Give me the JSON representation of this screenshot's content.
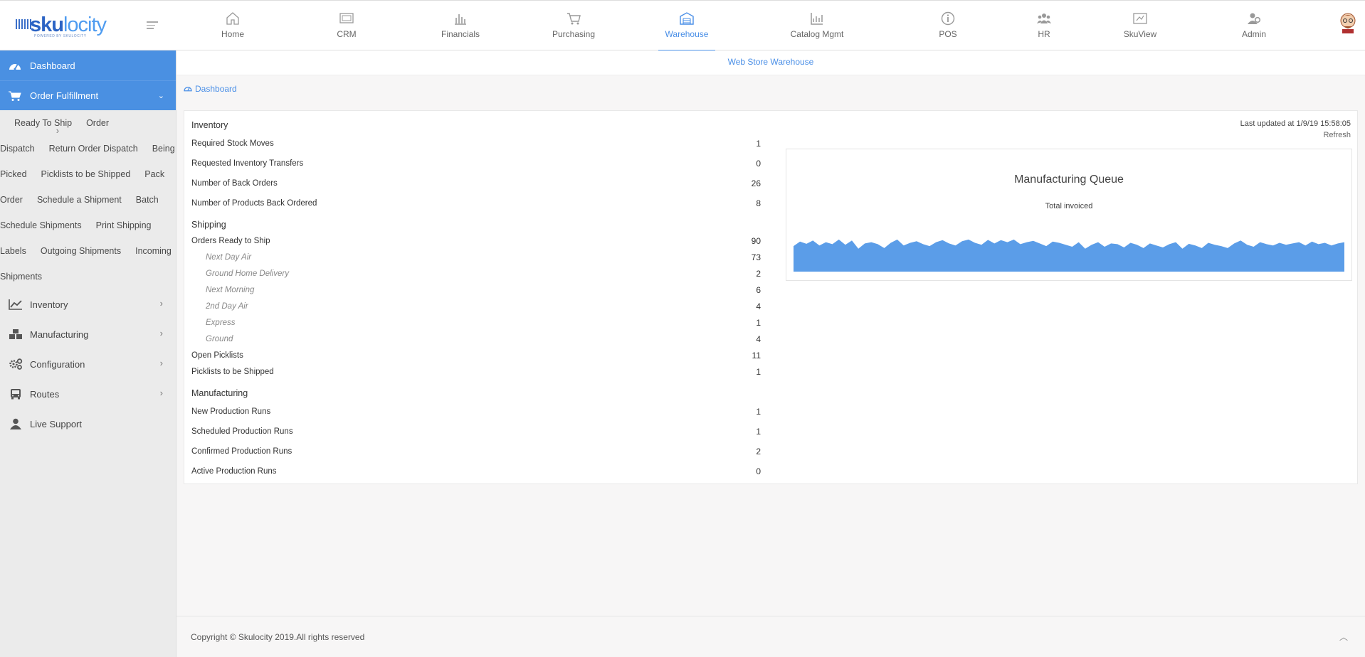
{
  "brand": {
    "name_a": "sku",
    "name_b": "locity",
    "tagline": "POWERED BY SKULOCITY"
  },
  "nav": [
    {
      "label": "Home",
      "icon": "home-icon",
      "active": false
    },
    {
      "label": "CRM",
      "icon": "crm-icon",
      "active": false
    },
    {
      "label": "Financials",
      "icon": "bar-chart-icon",
      "active": false
    },
    {
      "label": "Purchasing",
      "icon": "cart-icon",
      "active": false
    },
    {
      "label": "Warehouse",
      "icon": "warehouse-icon",
      "active": true
    },
    {
      "label": "Catalog Mgmt",
      "icon": "line-chart-icon",
      "active": false
    },
    {
      "label": "POS",
      "icon": "info-icon",
      "active": false
    },
    {
      "label": "HR",
      "icon": "people-icon",
      "active": false
    },
    {
      "label": "SkuView",
      "icon": "sku-view-icon",
      "active": false
    },
    {
      "label": "Admin",
      "icon": "admin-icon",
      "active": false
    }
  ],
  "sidebar": {
    "dashboard": "Dashboard",
    "order_fulfillment": "Order Fulfillment",
    "items": [
      {
        "label": "Ready To Ship",
        "chevron": false
      },
      {
        "label": "Order Dispatch",
        "chevron": true
      },
      {
        "label": "Return Order Dispatch",
        "chevron": false
      },
      {
        "label": "Being Picked",
        "chevron": false
      },
      {
        "label": "Picklists to be Shipped",
        "chevron": false
      },
      {
        "label": "Pack Order",
        "chevron": false
      },
      {
        "label": "Schedule a Shipment",
        "chevron": false
      },
      {
        "label": "Batch Schedule Shipments",
        "chevron": false
      },
      {
        "label": "Print Shipping Labels",
        "chevron": false
      },
      {
        "label": "Outgoing Shipments",
        "chevron": false
      },
      {
        "label": "Incoming Shipments",
        "chevron": false
      }
    ],
    "sections": [
      {
        "label": "Inventory",
        "icon": "trend-icon",
        "chevron": true
      },
      {
        "label": "Manufacturing",
        "icon": "boxes-icon",
        "chevron": true
      },
      {
        "label": "Configuration",
        "icon": "gears-icon",
        "chevron": true
      },
      {
        "label": "Routes",
        "icon": "bus-icon",
        "chevron": true
      },
      {
        "label": "Live Support",
        "icon": "user-icon",
        "chevron": false
      }
    ]
  },
  "store": "Web Store Warehouse",
  "breadcrumb": "Dashboard",
  "inventory": {
    "title": "Inventory",
    "rows": [
      {
        "label": "Required Stock Moves",
        "value": "1"
      },
      {
        "label": "Requested Inventory Transfers",
        "value": "0"
      },
      {
        "label": "Number of Back Orders",
        "value": "26"
      },
      {
        "label": "Number of Products Back Ordered",
        "value": "8"
      }
    ]
  },
  "shipping": {
    "title": "Shipping",
    "ready": {
      "label": "Orders Ready to Ship",
      "value": "90"
    },
    "methods": [
      {
        "label": "Next Day Air",
        "value": "73"
      },
      {
        "label": "Ground Home Delivery",
        "value": "2"
      },
      {
        "label": "Next Morning",
        "value": "6"
      },
      {
        "label": "2nd Day Air",
        "value": "4"
      },
      {
        "label": "Express",
        "value": "1"
      },
      {
        "label": "Ground",
        "value": "4"
      }
    ],
    "open_picklists": {
      "label": "Open Picklists",
      "value": "11"
    },
    "picklists_shipped": {
      "label": "Picklists to be Shipped",
      "value": "1"
    }
  },
  "manufacturing": {
    "title": "Manufacturing",
    "rows": [
      {
        "label": "New Production Runs",
        "value": "1"
      },
      {
        "label": "Scheduled Production Runs",
        "value": "1"
      },
      {
        "label": "Confirmed Production Runs",
        "value": "2"
      },
      {
        "label": "Active Production Runs",
        "value": "0"
      }
    ]
  },
  "last_updated": "Last updated at 1/9/19 15:58:05",
  "refresh": "Refresh",
  "chart_data": {
    "type": "area",
    "title": "Manufacturing Queue",
    "subtitle": "Total invoiced",
    "color": "#5b9de8",
    "values": [
      0.78,
      0.92,
      0.85,
      0.95,
      0.8,
      0.9,
      0.84,
      0.98,
      0.82,
      0.95,
      0.7,
      0.86,
      0.9,
      0.84,
      0.72,
      0.88,
      0.98,
      0.8,
      0.88,
      0.93,
      0.84,
      0.78,
      0.9,
      0.96,
      0.86,
      0.8,
      0.93,
      0.98,
      0.88,
      0.82,
      0.97,
      0.86,
      0.96,
      0.9,
      0.98,
      0.84,
      0.9,
      0.94,
      0.86,
      0.78,
      0.92,
      0.88,
      0.82,
      0.76,
      0.9,
      0.7,
      0.82,
      0.9,
      0.76,
      0.86,
      0.84,
      0.74,
      0.88,
      0.82,
      0.72,
      0.86,
      0.8,
      0.74,
      0.84,
      0.9,
      0.7,
      0.85,
      0.8,
      0.72,
      0.88,
      0.82,
      0.78,
      0.72,
      0.86,
      0.95,
      0.82,
      0.76,
      0.9,
      0.84,
      0.8,
      0.88,
      0.82,
      0.86,
      0.9,
      0.8,
      0.92,
      0.84,
      0.88,
      0.8,
      0.86,
      0.9
    ]
  },
  "footer": {
    "copyright": "Copyright © Skulocity 2019.All rights reserved"
  }
}
